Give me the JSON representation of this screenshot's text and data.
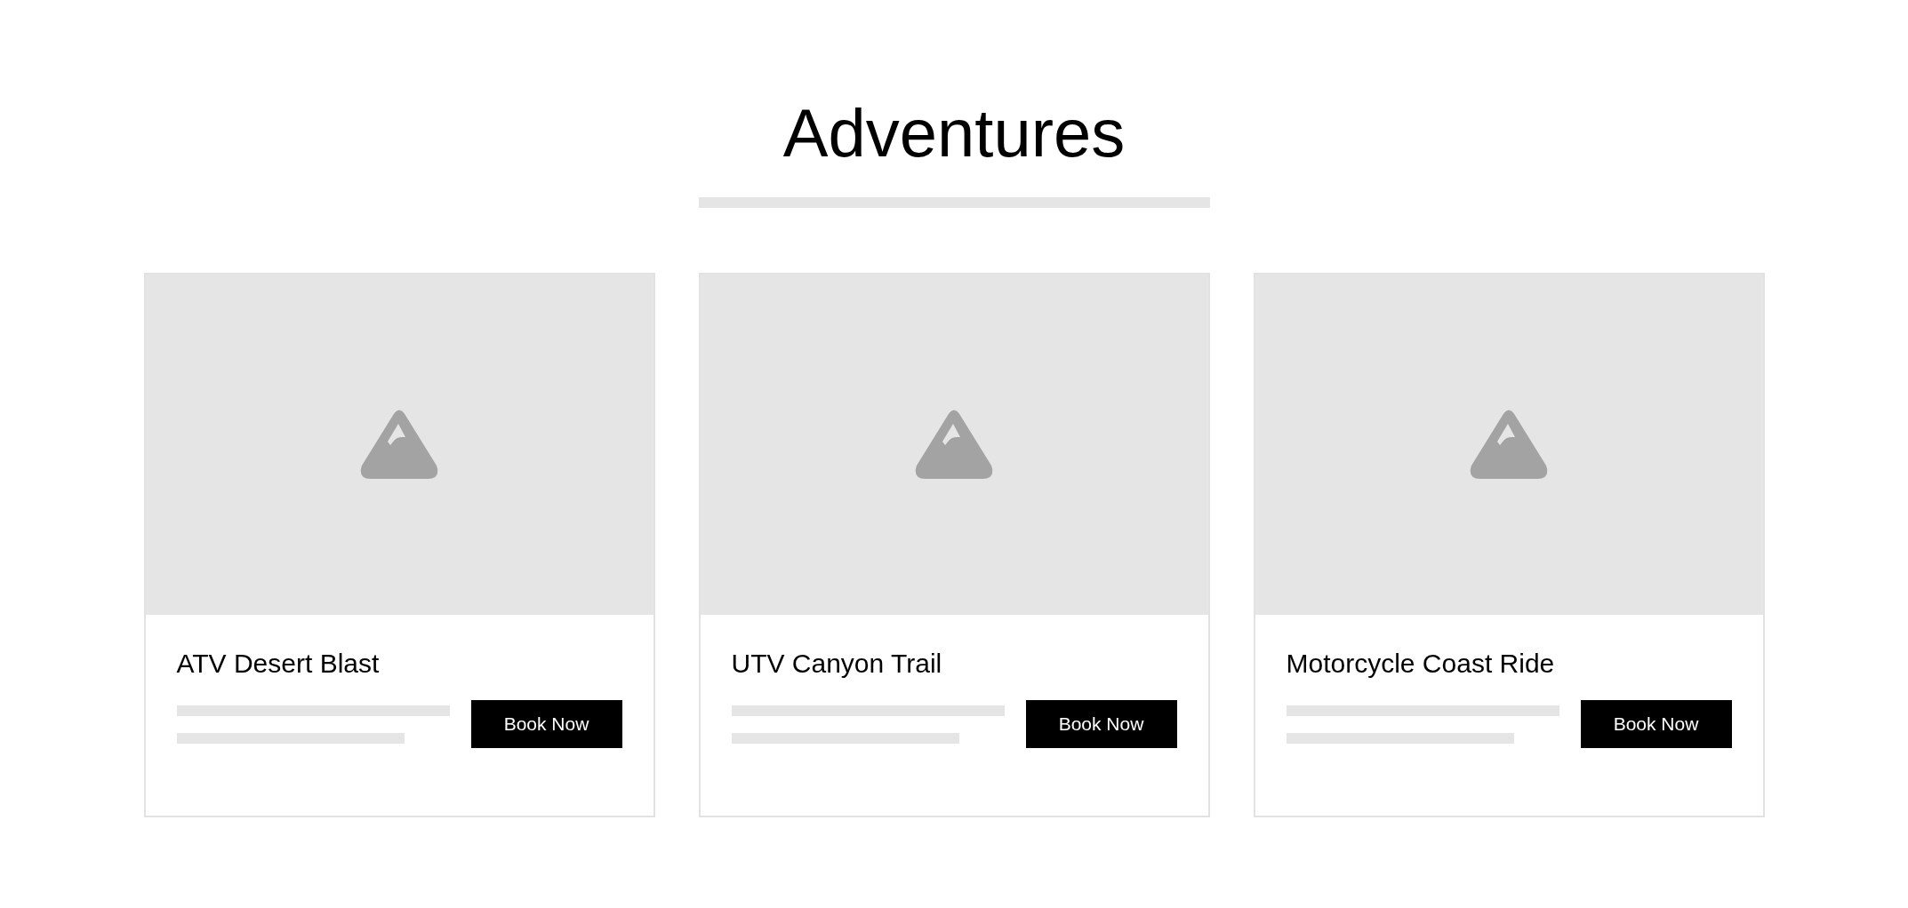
{
  "heading": "Adventures",
  "cards": [
    {
      "title": "ATV Desert Blast",
      "button": "Book Now"
    },
    {
      "title": "UTV Canyon Trail",
      "button": "Book Now"
    },
    {
      "title": "Motorcycle Coast Ride",
      "button": "Book Now"
    }
  ]
}
